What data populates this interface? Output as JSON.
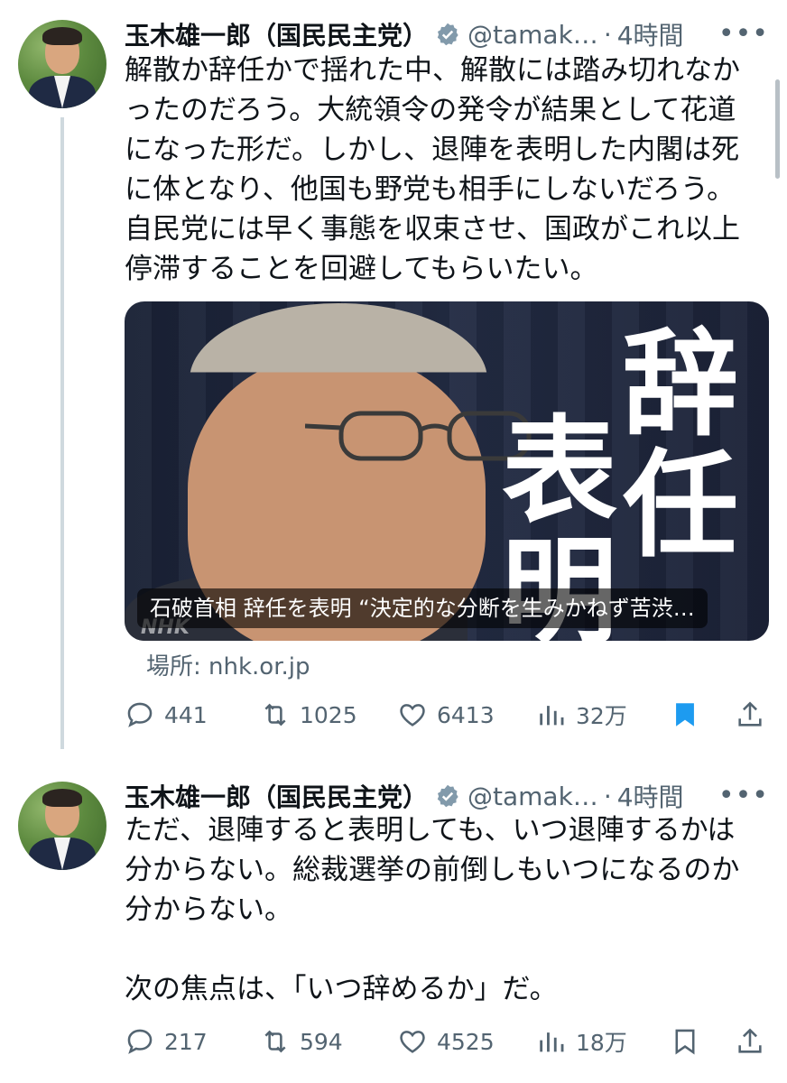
{
  "colors": {
    "text": "#0f1419",
    "secondary": "#536471",
    "verified": "#829aab",
    "bookmark": "#1d9bf0",
    "thread_line": "#cfd9de"
  },
  "tweets": [
    {
      "name": "玉木雄一郎（国民民主党）",
      "handle": "@tamak…",
      "dot": "·",
      "time": "4時間",
      "more": "•••",
      "text": "解散か辞任かで揺れた中、解散には踏み切れなか\nったのだろう。大統領令の発令が結果として花道\nになった形だ。しかし、退陣を表明した内閣は死\nに体となり、他国も野党も相手にしないだろう。\n自民党には早く事態を収束させ、国政がこれ以上\n停滞することを回避してもらいたい。",
      "card": {
        "caption": "石破首相 辞任を表明 “決定的な分断を生みかねず苦渋…",
        "overlay_chars": [
          "辞",
          "任",
          "表",
          "明"
        ],
        "watermark": "NHK",
        "source": "場所: nhk.or.jp"
      },
      "stats": {
        "replies": "441",
        "reposts": "1025",
        "likes": "6413",
        "views": "32万",
        "bookmarked": true
      }
    },
    {
      "name": "玉木雄一郎（国民民主党）",
      "handle": "@tamak…",
      "dot": "·",
      "time": "4時間",
      "more": "•••",
      "text": "ただ、退陣すると表明しても、いつ退陣するかは\n分からない。総裁選挙の前倒しもいつになるのか\n分からない。\n\n次の焦点は、「いつ辞めるか」だ。",
      "stats": {
        "replies": "217",
        "reposts": "594",
        "likes": "4525",
        "views": "18万",
        "bookmarked": false
      }
    }
  ]
}
